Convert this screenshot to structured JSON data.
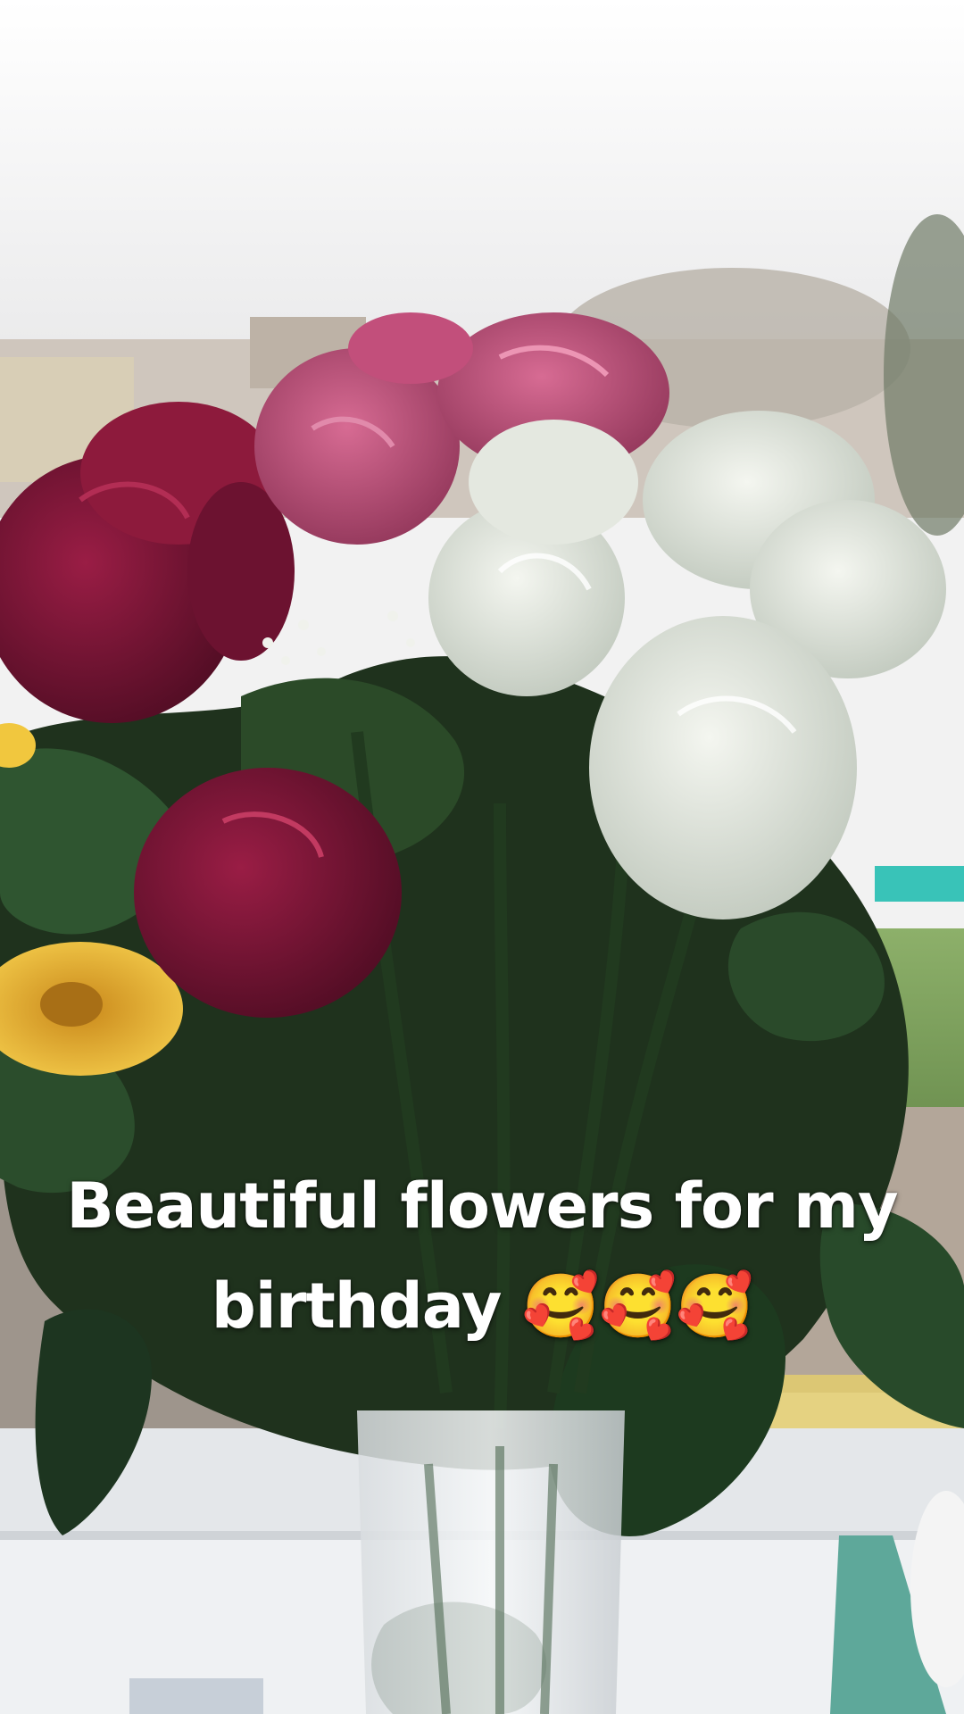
{
  "caption": {
    "line1": "Beautiful flowers for my",
    "line2": "birthday 🥰🥰🥰"
  },
  "palette": {
    "sky": "#f4f4f4",
    "pink_rose": "#b3476f",
    "crimson_rose": "#7a1233",
    "white_rose": "#e7ece3",
    "leaf": "#1f3a1e",
    "yellow_gerbera": "#f2c23a",
    "window_frame": "#e6e8ea"
  }
}
